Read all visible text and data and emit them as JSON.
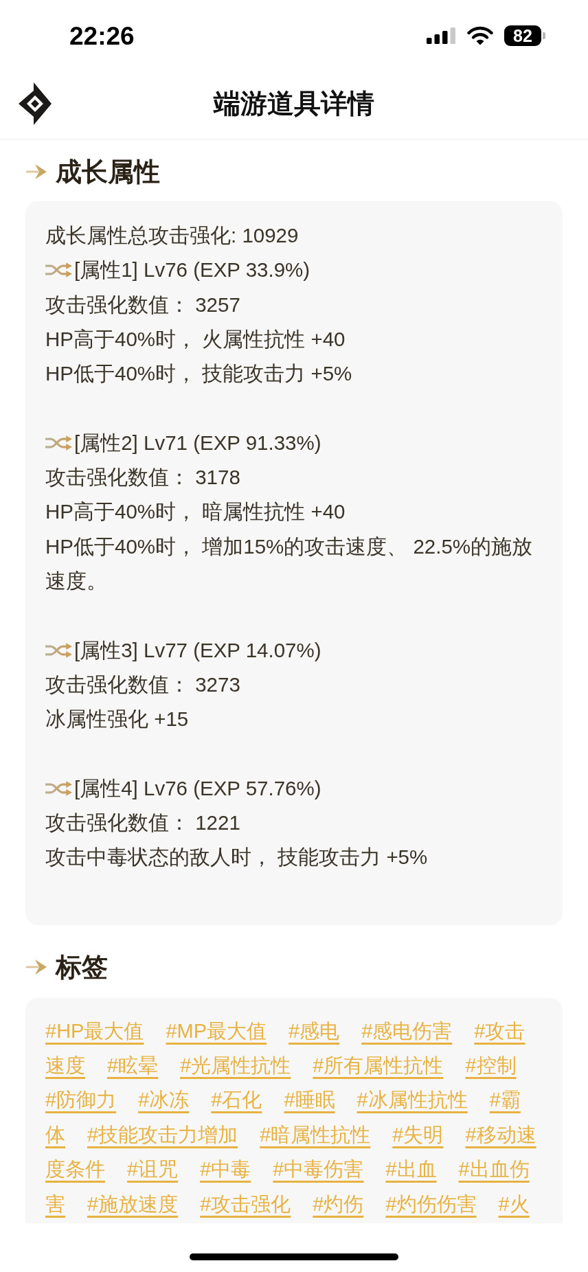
{
  "status_bar": {
    "time": "22:26",
    "battery": "82"
  },
  "header": {
    "title": "端游道具详情"
  },
  "growth_section": {
    "title": "成长属性",
    "summary": "成长属性总攻击强化: 10929",
    "attributes": [
      {
        "heading": "[属性1] Lv76 (EXP 33.9%)",
        "lines": [
          "攻击强化数值： 3257",
          "HP高于40%时， 火属性抗性 +40",
          "HP低于40%时， 技能攻击力 +5%"
        ]
      },
      {
        "heading": "[属性2] Lv71 (EXP 91.33%)",
        "lines": [
          "攻击强化数值： 3178",
          "HP高于40%时， 暗属性抗性 +40",
          "HP低于40%时， 增加15%的攻击速度、 22.5%的施放速度。"
        ]
      },
      {
        "heading": "[属性3] Lv77 (EXP 14.07%)",
        "lines": [
          "攻击强化数值： 3273",
          "冰属性强化 +15"
        ]
      },
      {
        "heading": "[属性4] Lv76 (EXP 57.76%)",
        "lines": [
          "攻击强化数值： 1221",
          "攻击中毒状态的敌人时， 技能攻击力 +5%"
        ]
      }
    ]
  },
  "tags_section": {
    "title": "标签",
    "tag_rows": [
      [
        "#HP最大值",
        "#MP最大值",
        "#感电",
        "#感电伤害",
        "#攻击"
      ],
      [
        "速度",
        "#眩晕",
        "#光属性抗性",
        "#所有属性抗性",
        "#控制"
      ],
      [
        "#防御力",
        "#冰冻",
        "#石化",
        "#睡眠",
        "#冰属性抗性",
        "#霸"
      ],
      [
        "体",
        "#技能攻击力增加",
        "#暗属性抗性",
        "#失明",
        "#移动速"
      ],
      [
        "度条件",
        "#诅咒",
        "#中毒",
        "#中毒伤害",
        "#出血",
        "#出血伤"
      ],
      [
        "害",
        "#施放速度",
        "#攻击强化",
        "#灼伤",
        "#灼伤伤害",
        "#火"
      ]
    ]
  }
}
